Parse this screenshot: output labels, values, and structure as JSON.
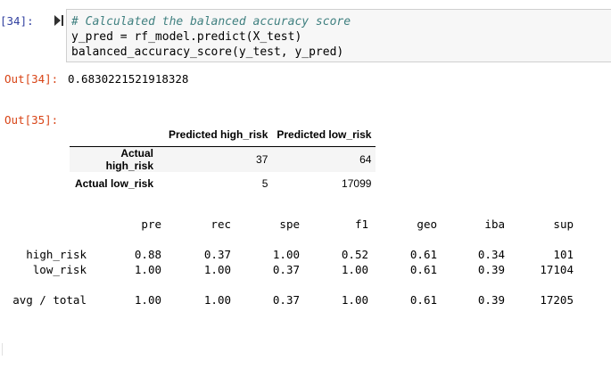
{
  "cell_in": {
    "prompt": "[34]:",
    "code": [
      "# Calculated the balanced accuracy score",
      "y_pred = rf_model.predict(X_test)",
      "balanced_accuracy_score(y_test, y_pred)"
    ]
  },
  "out34": {
    "prompt": "Out[34]:",
    "value": "0.6830221521918328"
  },
  "out35": {
    "prompt": "Out[35]:",
    "table": {
      "columns": [
        "Predicted high_risk",
        "Predicted low_risk"
      ],
      "rows": [
        {
          "label": "Actual high_risk",
          "values": [
            "37",
            "64"
          ]
        },
        {
          "label": "Actual low_risk",
          "values": [
            "5",
            "17099"
          ]
        }
      ]
    }
  },
  "report": {
    "headers": [
      "pre",
      "rec",
      "spe",
      "f1",
      "geo",
      "iba",
      "sup"
    ],
    "rows": [
      {
        "label": "high_risk",
        "values": [
          "0.88",
          "0.37",
          "1.00",
          "0.52",
          "0.61",
          "0.34",
          "101"
        ]
      },
      {
        "label": "low_risk",
        "values": [
          "1.00",
          "1.00",
          "0.37",
          "1.00",
          "0.61",
          "0.39",
          "17104"
        ]
      },
      {
        "label": "avg / total",
        "values": [
          "1.00",
          "1.00",
          "0.37",
          "1.00",
          "0.61",
          "0.39",
          "17205"
        ]
      }
    ]
  },
  "colors": {
    "prompt_in": "#303f9f",
    "prompt_out": "#d84315",
    "comment": "#408080",
    "cell_bg": "#f7f7f7"
  },
  "icons": {
    "run": "run-cell-icon"
  }
}
